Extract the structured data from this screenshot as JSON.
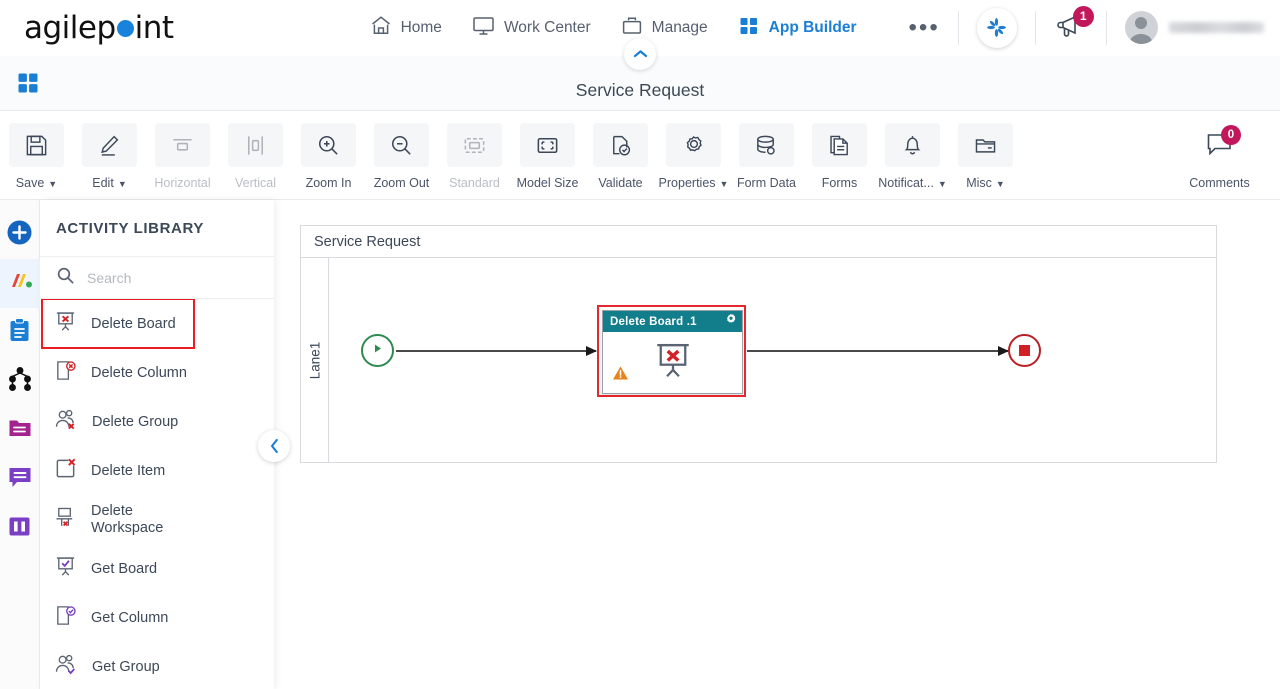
{
  "brand": {
    "name_part1": "agilep",
    "name_part2": "int",
    "dot_color": "#1783dc",
    "accent_blue": "#1a7fd4"
  },
  "header": {
    "nav": [
      {
        "label": "Home",
        "icon": "home-icon",
        "active": false
      },
      {
        "label": "Work Center",
        "icon": "monitor-icon",
        "active": false
      },
      {
        "label": "Manage",
        "icon": "briefcase-icon",
        "active": false
      },
      {
        "label": "App Builder",
        "icon": "grid-icon",
        "active": true
      }
    ],
    "more_label": "•••",
    "pinwheel_icon": "pinwheel-icon",
    "notifications": {
      "icon": "megaphone-icon",
      "count": "1",
      "badge_color": "#c2185b"
    },
    "avatar": {
      "icon": "avatar-icon",
      "username": ""
    }
  },
  "titlebar": {
    "grid_icon": "grid-apps-icon",
    "title": "Service Request",
    "collapse_icon": "chevron-up-icon"
  },
  "toolbar": {
    "items": [
      {
        "label": "Save",
        "icon": "floppy-disk-icon",
        "chevron": true,
        "disabled": false
      },
      {
        "label": "Edit",
        "icon": "pencil-icon",
        "chevron": true,
        "disabled": false
      },
      {
        "label": "Horizontal",
        "icon": "horizontal-align-icon",
        "chevron": false,
        "disabled": true
      },
      {
        "label": "Vertical",
        "icon": "vertical-align-icon",
        "chevron": false,
        "disabled": true
      },
      {
        "label": "Zoom In",
        "icon": "zoom-in-icon",
        "chevron": false,
        "disabled": false
      },
      {
        "label": "Zoom Out",
        "icon": "zoom-out-icon",
        "chevron": false,
        "disabled": false
      },
      {
        "label": "Standard",
        "icon": "standard-size-icon",
        "chevron": false,
        "disabled": true
      },
      {
        "label": "Model Size",
        "icon": "model-size-icon",
        "chevron": false,
        "disabled": false
      },
      {
        "label": "Validate",
        "icon": "validate-icon",
        "chevron": false,
        "disabled": false
      },
      {
        "label": "Properties",
        "icon": "gear-icon",
        "chevron": true,
        "disabled": false
      },
      {
        "label": "Form Data",
        "icon": "database-icon",
        "chevron": false,
        "disabled": false
      },
      {
        "label": "Forms",
        "icon": "document-icon",
        "chevron": false,
        "disabled": false
      },
      {
        "label": "Notificat...",
        "icon": "bell-icon",
        "chevron": true,
        "disabled": false
      },
      {
        "label": "Misc",
        "icon": "folder-icon",
        "chevron": true,
        "disabled": false
      }
    ],
    "comments": {
      "label": "Comments",
      "icon": "comment-bubble-icon",
      "count": "0",
      "badge_color": "#c2185b"
    }
  },
  "rail": {
    "items": [
      {
        "name": "add-icon",
        "selected": false
      },
      {
        "name": "stripes-icon",
        "selected": true
      },
      {
        "name": "clipboard-icon",
        "selected": false
      },
      {
        "name": "process-nodes-icon",
        "selected": false
      },
      {
        "name": "folder-magenta-icon",
        "selected": false
      },
      {
        "name": "speech-bubble-icon",
        "selected": false
      },
      {
        "name": "columns-icon",
        "selected": false
      }
    ]
  },
  "panel": {
    "title": "ACTIVITY LIBRARY",
    "search_placeholder": "Search",
    "search_value": "",
    "search_icon": "search-icon",
    "collapse_icon": "chevron-left-icon",
    "highlight_color": "#ec1c24",
    "items": [
      {
        "label": "Delete Board",
        "icon": "board-delete-icon",
        "highlighted": true
      },
      {
        "label": "Delete Column",
        "icon": "column-delete-icon",
        "highlighted": false
      },
      {
        "label": "Delete Group",
        "icon": "group-delete-icon",
        "highlighted": false
      },
      {
        "label": "Delete Item",
        "icon": "item-delete-icon",
        "highlighted": false
      },
      {
        "label": "Delete\nWorkspace",
        "icon": "workspace-delete-icon",
        "highlighted": false
      },
      {
        "label": "Get Board",
        "icon": "board-get-icon",
        "highlighted": false
      },
      {
        "label": "Get Column",
        "icon": "column-get-icon",
        "highlighted": false
      },
      {
        "label": "Get Group",
        "icon": "group-get-icon",
        "highlighted": false
      }
    ]
  },
  "canvas": {
    "pool_title": "Service Request",
    "lane_label": "Lane1",
    "start_node": {
      "name": "start-event",
      "icon": "play-triangle-icon",
      "color": "#2e8b4f"
    },
    "end_node": {
      "name": "end-event",
      "icon": "stop-square-icon",
      "color": "#b82025"
    },
    "activity": {
      "title": "Delete Board .1",
      "header_color": "#127d8b",
      "settings_icon": "gear-icon",
      "body_icon": "board-delete-icon",
      "warning_icon": "warning-triangle-icon",
      "selected": true,
      "selection_color": "#e8262d"
    }
  }
}
